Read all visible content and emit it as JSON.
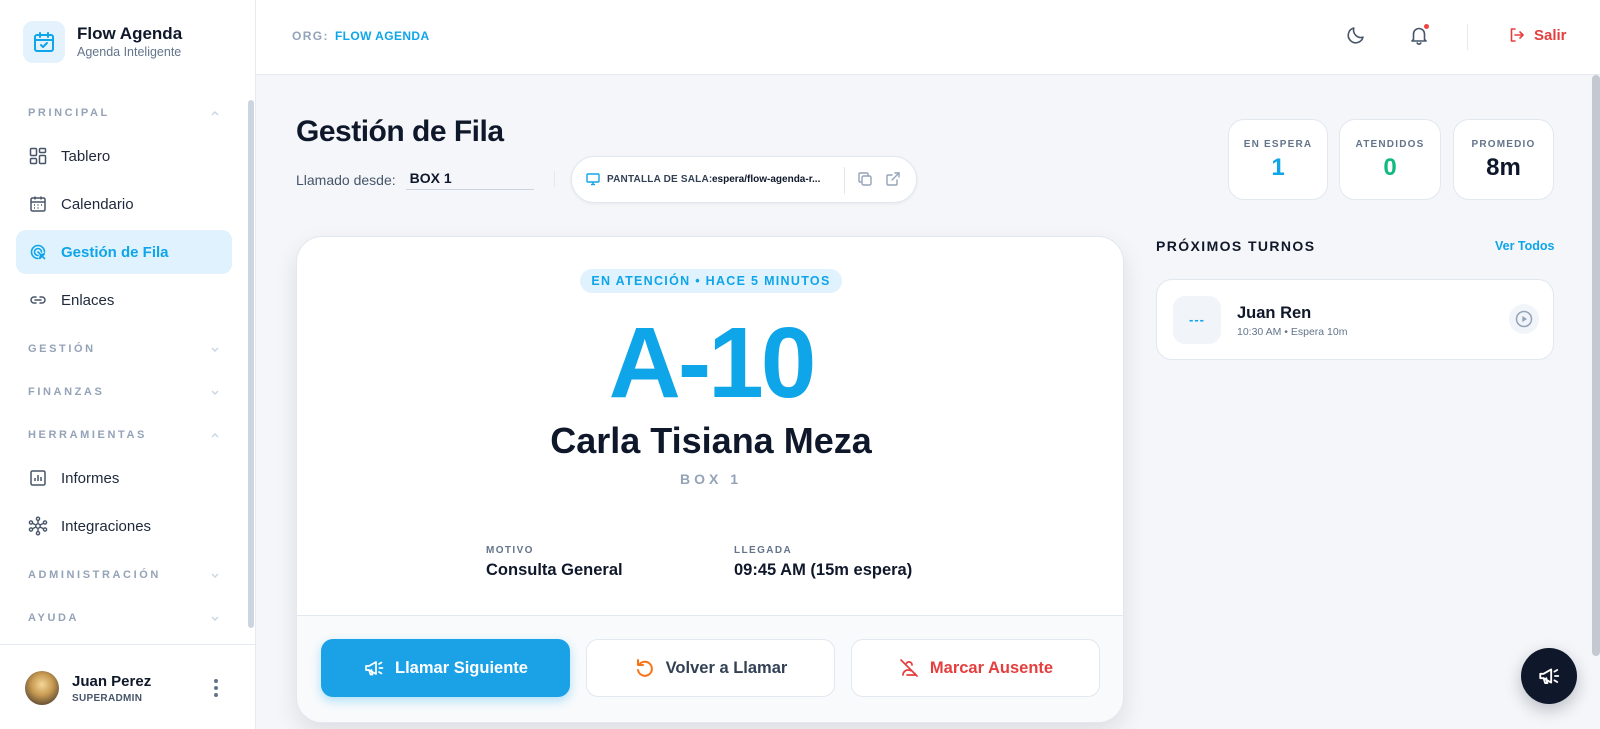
{
  "brand": {
    "name": "Flow Agenda",
    "subtitle": "Agenda Inteligente"
  },
  "sidebar": {
    "principal": {
      "label": "PRINCIPAL"
    },
    "items": [
      {
        "label": "Tablero",
        "icon": "dashboard-grid-icon"
      },
      {
        "label": "Calendario",
        "icon": "calendar-icon"
      },
      {
        "label": "Gestión de Fila",
        "icon": "queue-icon",
        "active": true
      },
      {
        "label": "Enlaces",
        "icon": "link-icon"
      }
    ],
    "gestion": {
      "label": "GESTIÓN"
    },
    "finanzas": {
      "label": "FINANZAS"
    },
    "herramientas": {
      "label": "HERRAMIENTAS"
    },
    "tools": [
      {
        "label": "Informes",
        "icon": "report-chart-icon"
      },
      {
        "label": "Integraciones",
        "icon": "integrations-network-icon"
      }
    ],
    "administracion": {
      "label": "ADMINISTRACIÓN"
    },
    "ayuda": {
      "label": "AYUDA"
    }
  },
  "user": {
    "name": "Juan Perez",
    "role": "SUPERADMIN"
  },
  "header": {
    "org_label": "ORG:",
    "org_value": "FLOW AGENDA",
    "logout_label": "Salir"
  },
  "page": {
    "title": "Gestión de Fila",
    "called_from_label": "Llamado desde:",
    "called_from_value": "BOX 1",
    "screen_label": "PANTALLA DE SALA:",
    "screen_value": "espera/flow-agenda-r..."
  },
  "stats": [
    {
      "label": "EN ESPERA",
      "value": "1",
      "color": "#0ea5e9"
    },
    {
      "label": "ATENDIDOS",
      "value": "0",
      "color": "#10b981"
    },
    {
      "label": "PROMEDIO",
      "value": "8m",
      "color": "#0f172a"
    }
  ],
  "current": {
    "badge": "EN ATENCIÓN • HACE 5 MINUTOS",
    "ticket": "A-10",
    "patient": "Carla Tisiana Meza",
    "box": "BOX 1",
    "reason_label": "MOTIVO",
    "reason_value": "Consulta General",
    "arrival_label": "LLEGADA",
    "arrival_value": "09:45 AM (15m espera)"
  },
  "actions": {
    "next": "Llamar Siguiente",
    "recall": "Volver a Llamar",
    "absent": "Marcar Ausente"
  },
  "upcoming": {
    "title": "PRÓXIMOS TURNOS",
    "view_all": "Ver Todos",
    "items": [
      {
        "slot": "---",
        "name": "Juan Ren",
        "meta": "10:30 AM • Espera 10m"
      }
    ]
  },
  "colors": {
    "accent": "#0ea5e9",
    "success": "#10b981",
    "danger": "#e53e3e",
    "ink": "#0f172a"
  }
}
